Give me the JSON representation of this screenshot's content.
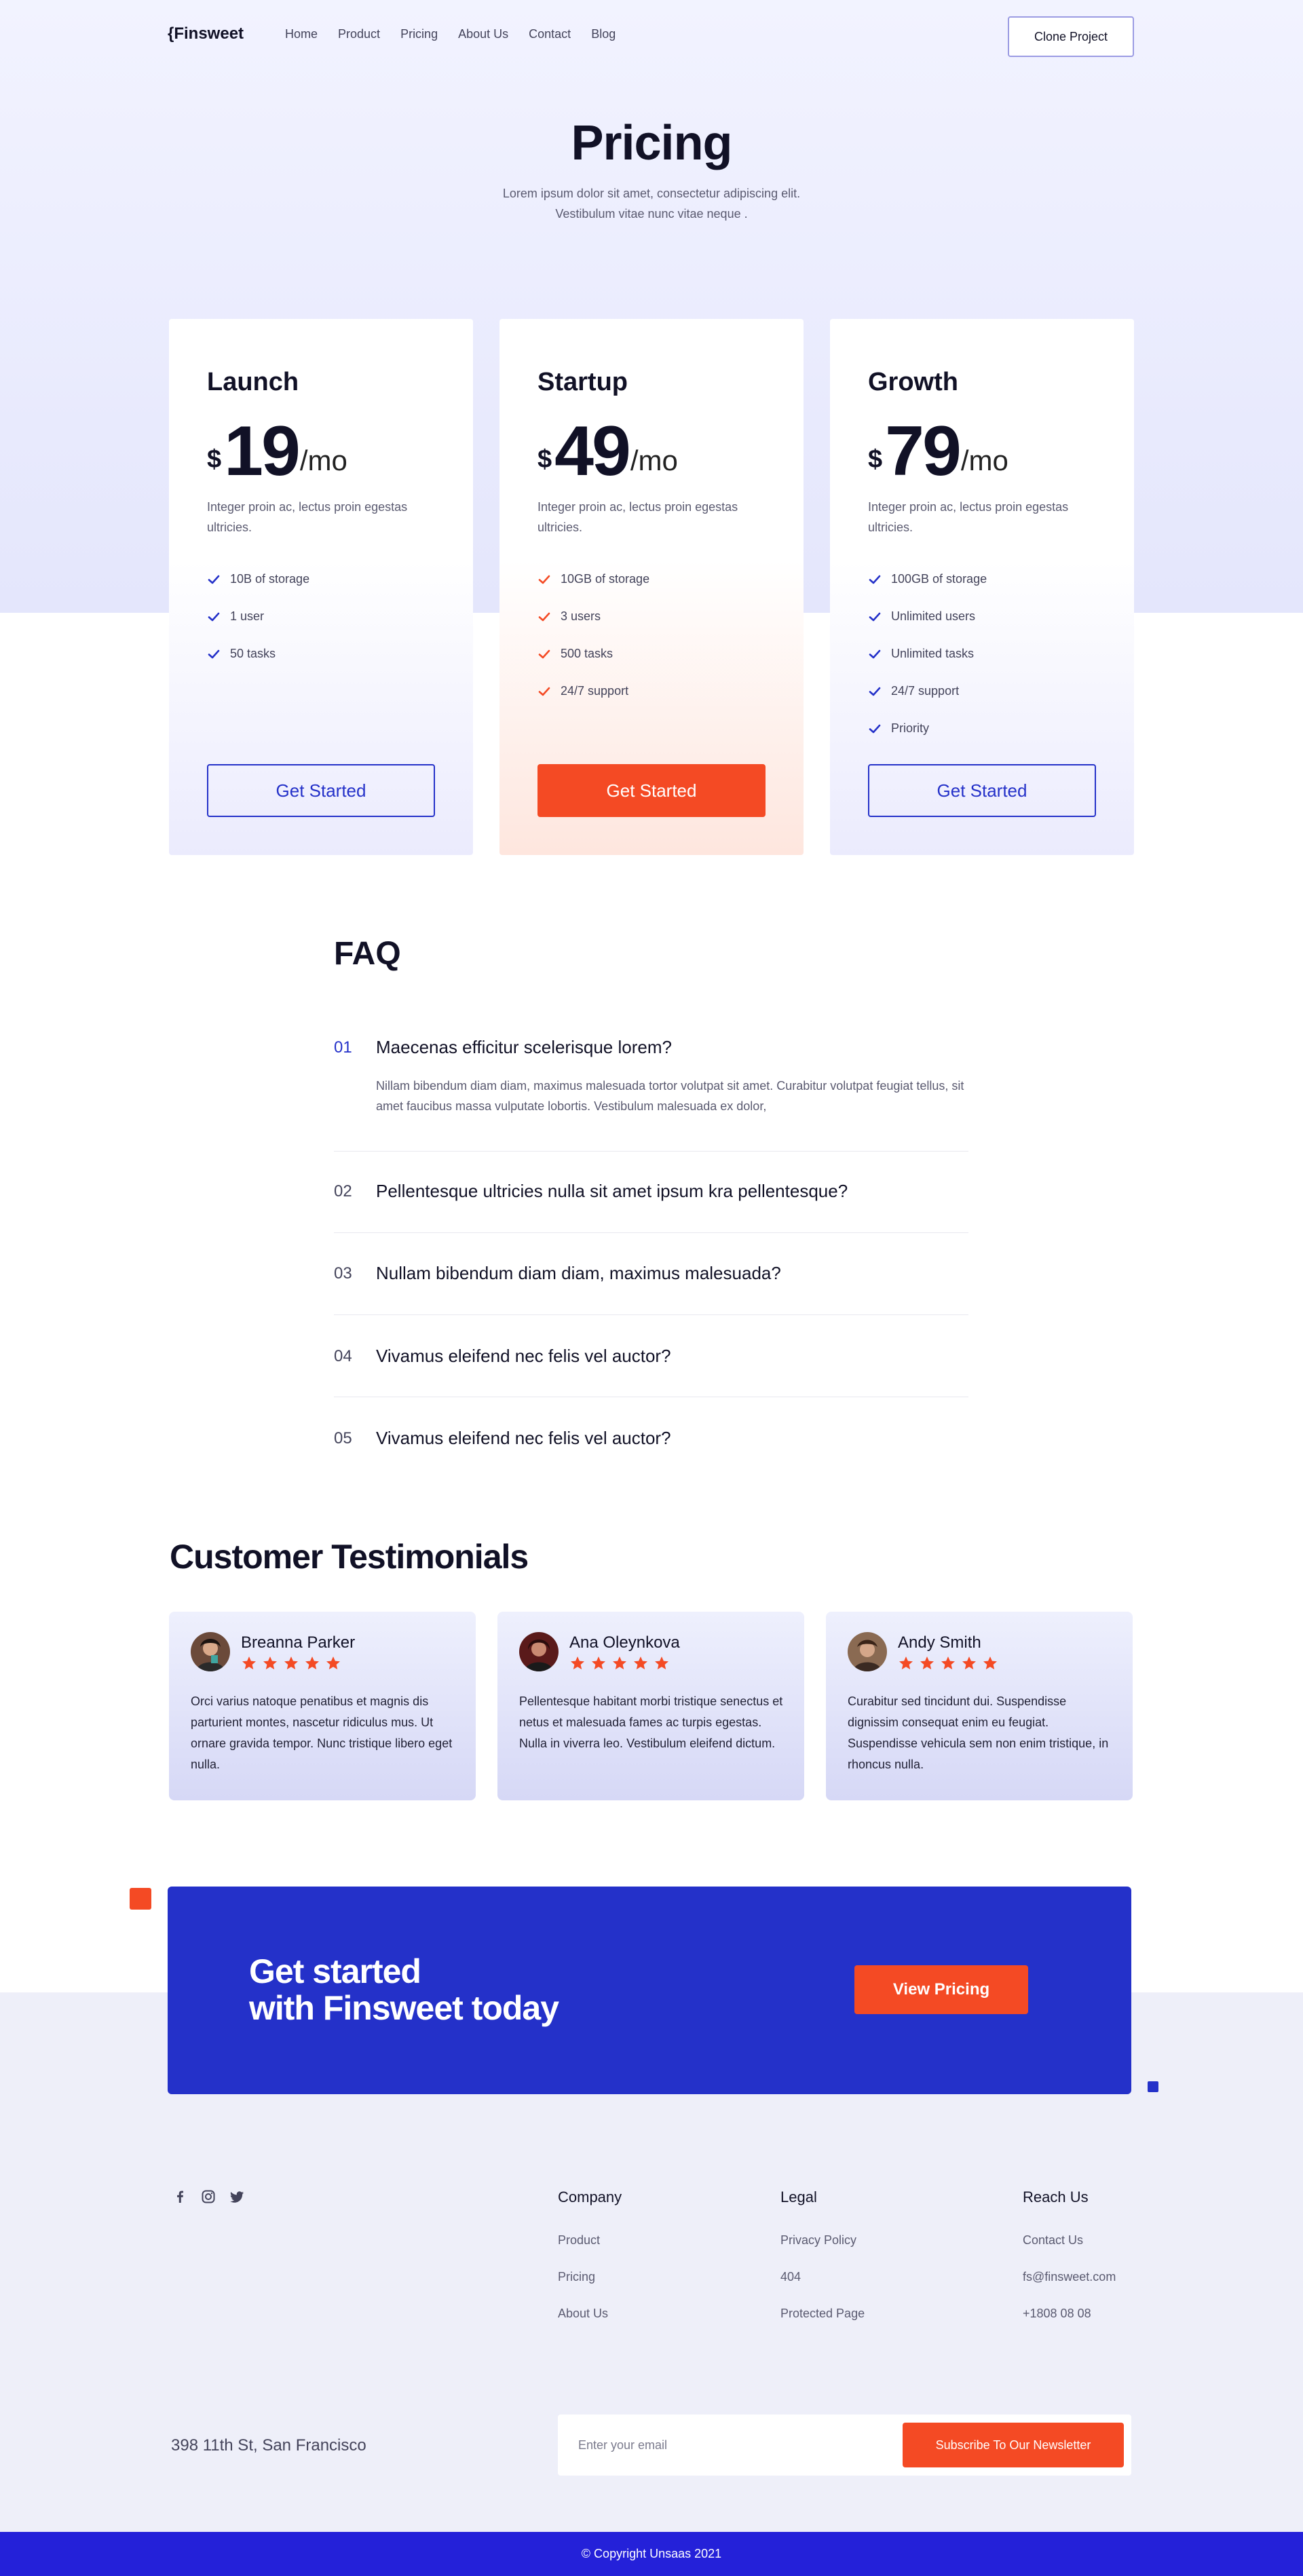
{
  "header": {
    "logo": "{Finsweet",
    "nav": [
      "Home",
      "Product",
      "Pricing",
      "About Us",
      "Contact",
      "Blog"
    ],
    "clone_button": "Clone Project"
  },
  "hero": {
    "title": "Pricing",
    "subtitle": "Lorem ipsum dolor sit amet, consectetur adipiscing elit. Vestibulum vitae nunc vitae neque ."
  },
  "plans": [
    {
      "name": "Launch",
      "currency": "$",
      "amount": "19",
      "period": "/mo",
      "description": "Integer proin ac, lectus proin egestas ultricies.",
      "features": [
        "10B of storage",
        "1 user",
        "50 tasks"
      ],
      "cta": "Get Started",
      "check_color": "#2431c9"
    },
    {
      "name": "Startup",
      "currency": "$",
      "amount": "49",
      "period": "/mo",
      "description": "Integer proin ac, lectus proin egestas ultricies.",
      "features": [
        "10GB of storage",
        "3 users",
        "500 tasks",
        "24/7 support"
      ],
      "cta": "Get Started",
      "check_color": "#f44a24"
    },
    {
      "name": "Growth",
      "currency": "$",
      "amount": "79",
      "period": "/mo",
      "description": "Integer proin ac, lectus proin egestas ultricies.",
      "features": [
        "100GB of storage",
        "Unlimited users",
        "Unlimited tasks",
        "24/7 support",
        "Priority"
      ],
      "cta": "Get Started",
      "check_color": "#2431c9"
    }
  ],
  "faq": {
    "title": "FAQ",
    "items": [
      {
        "num": "01",
        "question": "Maecenas efficitur scelerisque lorem?",
        "answer": "Nillam bibendum diam diam, maximus malesuada tortor volutpat sit amet. Curabitur volutpat feugiat tellus, sit amet faucibus massa vulputate lobortis. Vestibulum malesuada ex dolor,"
      },
      {
        "num": "02",
        "question": "Pellentesque ultricies nulla sit amet ipsum kra pellentesque?"
      },
      {
        "num": "03",
        "question": "Nullam bibendum diam diam, maximus malesuada?"
      },
      {
        "num": "04",
        "question": "Vivamus eleifend nec felis vel auctor?"
      },
      {
        "num": "05",
        "question": "Vivamus eleifend nec felis vel auctor?"
      }
    ]
  },
  "testimonials": {
    "title": "Customer Testimonials",
    "rating": 5,
    "items": [
      {
        "name": "Breanna Parker",
        "text": "Orci varius natoque penatibus et magnis dis parturient montes, nascetur ridiculus mus. Ut ornare gravida tempor. Nunc tristique libero eget nulla."
      },
      {
        "name": "Ana Oleynkova",
        "text": "Pellentesque habitant morbi tristique senectus et netus et malesuada fames ac turpis egestas. Nulla in viverra leo. Vestibulum eleifend dictum."
      },
      {
        "name": "Andy Smith",
        "text": "Curabitur sed tincidunt dui. Suspendisse dignissim consequat enim eu feugiat. Suspendisse vehicula sem non enim tristique, in rhoncus nulla."
      }
    ]
  },
  "cta": {
    "line1": "Get started",
    "line2": "with Finsweet today",
    "button": "View Pricing"
  },
  "footer": {
    "social": [
      "facebook-icon",
      "instagram-icon",
      "twitter-icon"
    ],
    "columns": [
      {
        "heading": "Company",
        "links": [
          "Product",
          "Pricing",
          "About Us"
        ]
      },
      {
        "heading": "Legal",
        "links": [
          "Privacy Policy",
          "404",
          "Protected Page"
        ]
      },
      {
        "heading": "Reach Us",
        "links": [
          "Contact Us",
          "fs@finsweet.com",
          "+1808 08 08"
        ]
      }
    ],
    "address": "398 11th St, San Francisco",
    "email_placeholder": "Enter your email",
    "subscribe": "Subscribe To Our Newsletter",
    "copyright": "© Copyright Unsaas 2021"
  },
  "colors": {
    "brand_blue": "#2431c9",
    "accent_orange": "#f44a24",
    "footer_blue": "#2421d9"
  }
}
